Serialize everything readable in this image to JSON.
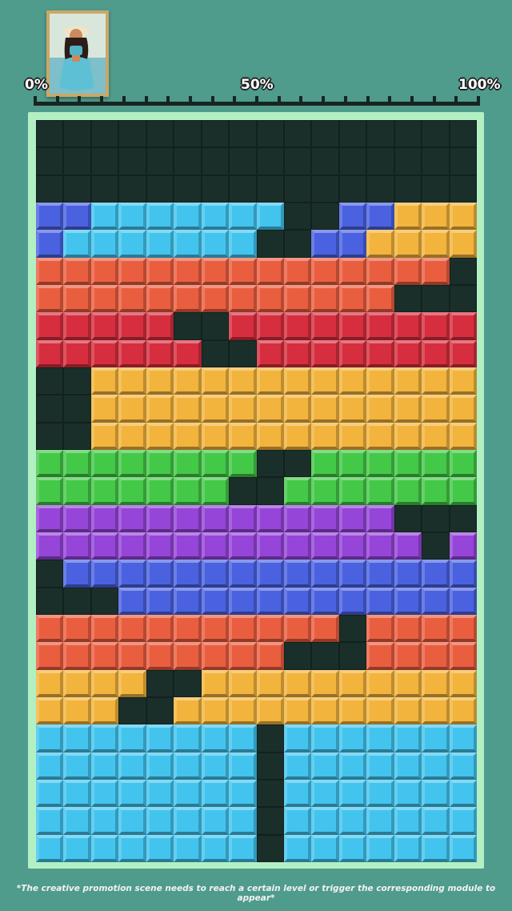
{
  "progress": {
    "label_start": "0%",
    "label_mid": "50%",
    "label_end": "100%"
  },
  "portrait": {
    "subject": "princess-portrait"
  },
  "colors": {
    "background": "#4f9b8c",
    "frame": "#b2f0c4",
    "empty": "#1b2f2a",
    "blue": "#4a62e0",
    "cyan": "#43c4ee",
    "yellow": "#f2b43c",
    "orange": "#ea5e40",
    "red": "#d62e3e",
    "green": "#44c848",
    "purple": "#9545d8"
  },
  "board": {
    "columns": 16,
    "rows": 27,
    "legend": {
      ".": "empty",
      "B": "blue",
      "C": "cyan",
      "Y": "yellow",
      "O": "orange",
      "R": "red",
      "G": "green",
      "P": "purple"
    },
    "grid": [
      "................",
      "................",
      "................",
      "BBCCCCCCC..BBYYY",
      "BCCCCCCC..BBYYYY",
      "OOOOOOOOOOOOOOO.",
      "OOOOOOOOOOOOO...",
      "RRRRR..RRRRRRRRR",
      "RRRRRR..RRRRRRRR",
      "..YYYYYYYYYYYYYY",
      "..YYYYYYYYYYYYYY",
      "..YYYYYYYYYYYYYY",
      "GGGGGGGG..GGGGGG",
      "GGGGGGG..GGGGGGG",
      "PPPPPPPPPPPPP...",
      "PPPPPPPPPPPPPP.P",
      ".BBBBBBBBBBBBBBB",
      "...BBBBBBBBBBBBB",
      "OOOOOOOOOOO.OOOO",
      "OOOOOOOOO...OOOO",
      "YYYY..YYYYYYYYYY",
      "YYY..YYYYYYYYYYY",
      "CCCCCCCC.CCCCCCC",
      "CCCCCCCC.CCCCCCC",
      "CCCCCCCC.CCCCCCC",
      "CCCCCCCC.CCCCCCC",
      "CCCCCCCC.CCCCCCC"
    ]
  },
  "footnote": "*The creative promotion scene needs to reach a certain level or trigger the corresponding module to appear*"
}
